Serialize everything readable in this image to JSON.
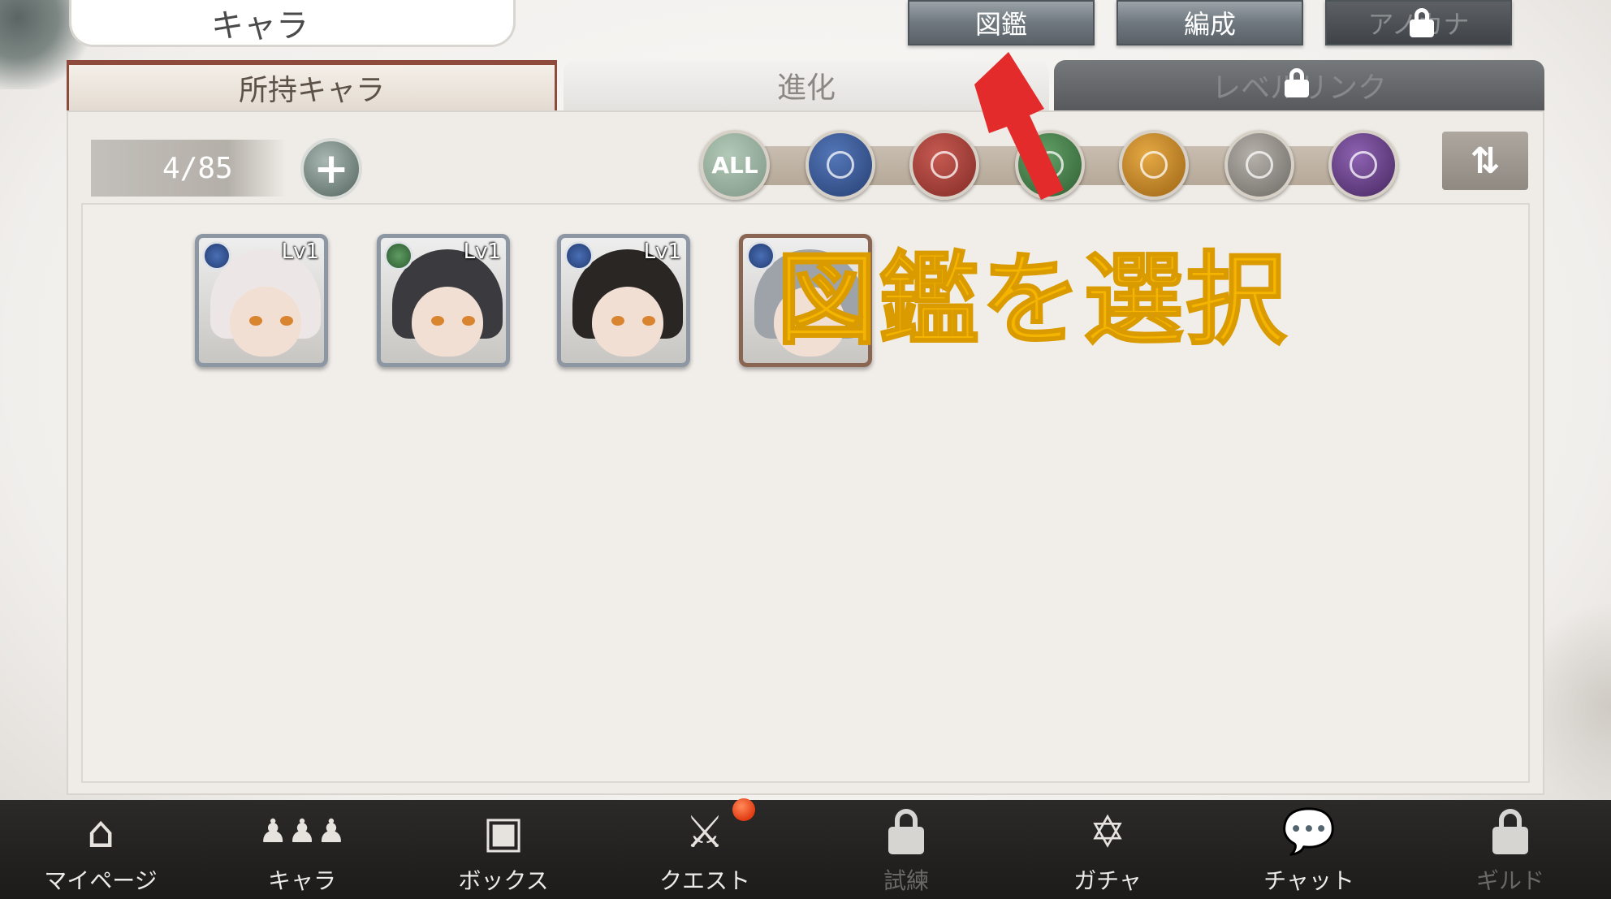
{
  "header": {
    "title": "キャラ",
    "buttons": {
      "zukan": "図鑑",
      "hensei": "編成",
      "anaguna": "アノカナ"
    }
  },
  "tabs": {
    "owned": "所持キャラ",
    "evolve": "進化",
    "level": "レベルリンク"
  },
  "toolbar": {
    "count": "4/85",
    "plus_label": "+",
    "filter_all": "ALL",
    "sort_label": "⇅"
  },
  "filters": [
    {
      "name": "all",
      "color": "#8ea494"
    },
    {
      "name": "water",
      "color": "#2f4f8e"
    },
    {
      "name": "fire",
      "color": "#a23b34"
    },
    {
      "name": "wind",
      "color": "#3f7a45"
    },
    {
      "name": "light",
      "color": "#c0821d"
    },
    {
      "name": "neutral",
      "color": "#8c8884"
    },
    {
      "name": "dark",
      "color": "#5c3a7a"
    }
  ],
  "characters": [
    {
      "level": "Lv1",
      "element": "water",
      "hair": "#ece7e6"
    },
    {
      "level": "Lv1",
      "element": "wind",
      "hair": "#3b3a3f"
    },
    {
      "level": "Lv1",
      "element": "water",
      "hair": "#2a2624"
    },
    {
      "level": "",
      "element": "water",
      "hair": "#9ea3a9"
    }
  ],
  "annotation": {
    "text": "図鑑を選択",
    "color": "#f5b400"
  },
  "nav": [
    {
      "label": "マイページ",
      "icon": "home-icon",
      "locked": false
    },
    {
      "label": "キャラ",
      "icon": "people-icon",
      "locked": false
    },
    {
      "label": "ボックス",
      "icon": "box-icon",
      "locked": false
    },
    {
      "label": "クエスト",
      "icon": "crossed-swords-icon",
      "locked": false,
      "badge": true
    },
    {
      "label": "試練",
      "icon": "lock-icon",
      "locked": true
    },
    {
      "label": "ガチャ",
      "icon": "hexagram-icon",
      "locked": false
    },
    {
      "label": "チャット",
      "icon": "chat-icon",
      "locked": false
    },
    {
      "label": "ギルド",
      "icon": "lock-icon",
      "locked": true
    }
  ]
}
